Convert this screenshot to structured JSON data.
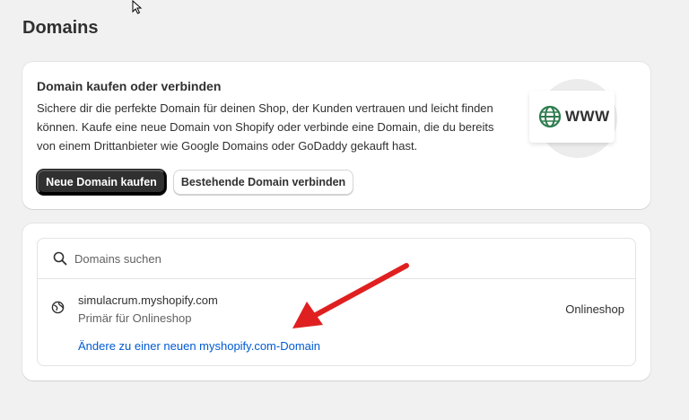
{
  "page": {
    "title": "Domains"
  },
  "intro_card": {
    "heading": "Domain kaufen oder verbinden",
    "description": "Sichere dir die perfekte Domain für deinen Shop, der Kunden vertrauen und leicht finden können. Kaufe eine neue Domain von Shopify oder verbinde eine Domain, die du bereits von einem Drittanbieter wie Google Domains oder GoDaddy gekauft hast.",
    "primary_button": "Neue Domain kaufen",
    "secondary_button": "Bestehende Domain verbinden",
    "illustration_text": "WWW"
  },
  "domains": {
    "search_placeholder": "Domains suchen",
    "items": [
      {
        "name": "simulacrum.myshopify.com",
        "subtitle": "Primär für Onlineshop",
        "channel": "Onlineshop",
        "link": "Ändere zu einer neuen myshopify.com-Domain"
      }
    ]
  },
  "colors": {
    "background": "#f1f1f1",
    "card": "#ffffff",
    "primary_button": "#303030",
    "link": "#005bd3",
    "globe_green": "#2e7d4f",
    "annotation_arrow": "#e02020"
  },
  "icons": [
    "cursor-icon",
    "globe-icon",
    "search-icon",
    "domain-globe-icon",
    "annotation-arrow"
  ]
}
